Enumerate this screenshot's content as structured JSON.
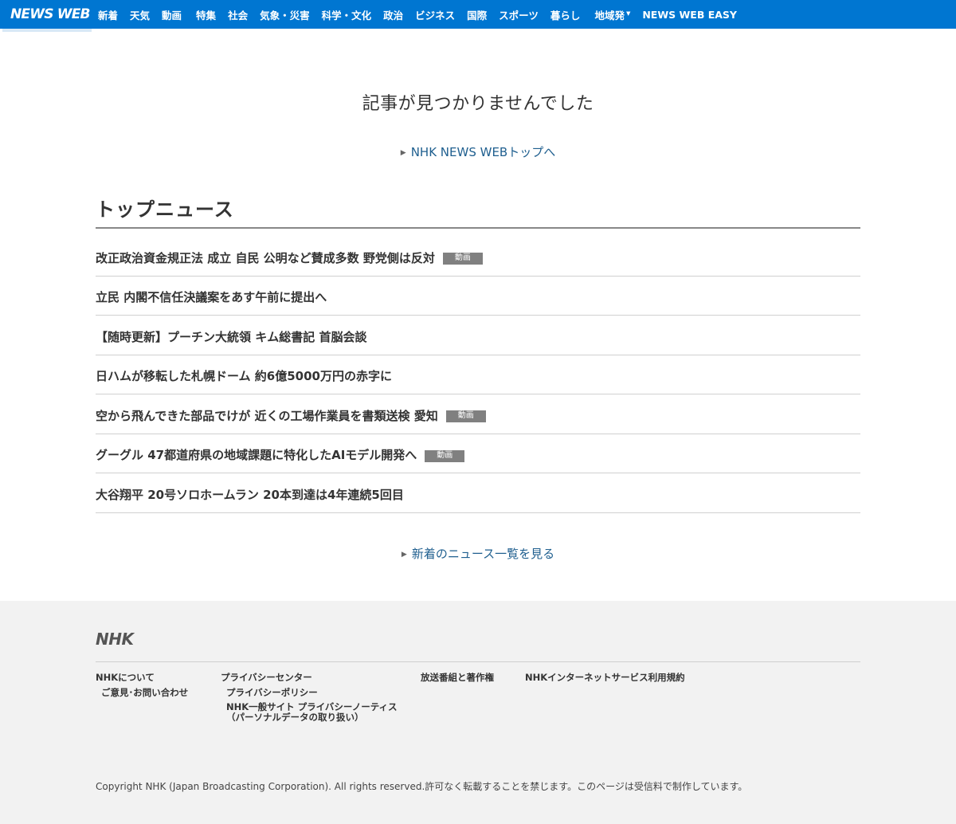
{
  "header": {
    "logo": "NEWS WEB",
    "nav": [
      "新着",
      "天気",
      "動画",
      "特集",
      "社会",
      "気象・災害",
      "科学・文化",
      "政治",
      "ビジネス",
      "国際",
      "スポーツ",
      "暮らし",
      "地域発",
      "NEWS WEB EASY"
    ],
    "colors": {
      "bar": "#0076d1"
    }
  },
  "main": {
    "not_found_message": "記事が見つかりませんでした",
    "top_link": "NHK NEWS WEBトップへ",
    "section_title": "トップニュース",
    "news": [
      {
        "title": "改正政治資金規正法 成立 自民 公明など賛成多数 野党側は反対",
        "badge": "動画"
      },
      {
        "title": "立民 内閣不信任決議案をあす午前に提出へ",
        "badge": ""
      },
      {
        "title": "【随時更新】プーチン大統領 キム総書記 首脳会談",
        "badge": ""
      },
      {
        "title": "日ハムが移転した札幌ドーム 約6億5000万円の赤字に",
        "badge": ""
      },
      {
        "title": "空から飛んできた部品でけが 近くの工場作業員を書類送検 愛知",
        "badge": "動画"
      },
      {
        "title": "グーグル 47都道府県の地域課題に特化したAIモデル開発へ",
        "badge": "動画"
      },
      {
        "title": "大谷翔平 20号ソロホームラン 20本到達は4年連続5回目",
        "badge": ""
      }
    ],
    "more_link": "新着のニュース一覧を見る"
  },
  "footer": {
    "logo": "NHK",
    "links": {
      "about": "NHKについて",
      "contact": "ご意見･お問い合わせ",
      "privacy_center": "プライバシーセンター",
      "privacy_policy": "プライバシーポリシー",
      "privacy_notice_line1": "NHK一般サイト プライバシーノーティス",
      "privacy_notice_line2": "（パーソナルデータの取り扱い）",
      "copyright_works": "放送番組と著作権",
      "terms": "NHKインターネットサービス利用規約"
    },
    "copyright": "Copyright NHK (Japan Broadcasting Corporation). All rights reserved.許可なく転載することを禁じます。このページは受信料で制作しています。"
  }
}
